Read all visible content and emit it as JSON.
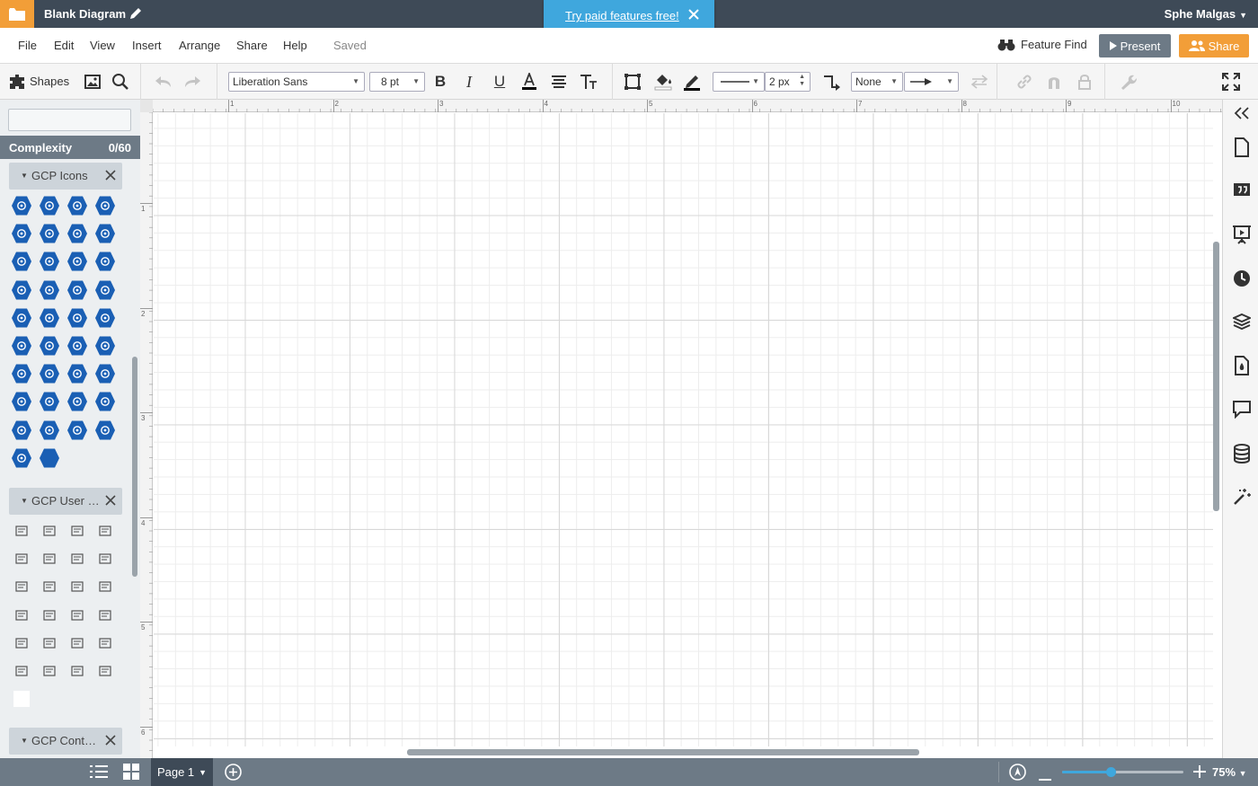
{
  "topbar": {
    "doc_title": "Blank Diagram",
    "promo_text": "Try paid features free!",
    "user_name": "Sphe Malgas",
    "user_caret": "▼"
  },
  "menu": {
    "items": [
      "File",
      "Edit",
      "View",
      "Insert",
      "Arrange",
      "Share",
      "Help"
    ],
    "status": "Saved",
    "feature_find": "Feature Find",
    "present": "Present",
    "share": "Share"
  },
  "toolbar": {
    "shapes_label": "Shapes",
    "font_family": "Liberation Sans",
    "font_size": "8 pt",
    "line_width": "2 px",
    "line_start": "None"
  },
  "sidebar": {
    "search_placeholder": "",
    "complexity_label": "Complexity",
    "complexity_value": "0/60",
    "libraries": [
      {
        "label": "GCP Icons"
      },
      {
        "label": "GCP User a…"
      },
      {
        "label": "GCP Contai…"
      }
    ],
    "gcp_icon_count": 38,
    "user_icon_count": 25
  },
  "colors": {
    "topbar": "#3e4a57",
    "accent_orange": "#f29e38",
    "promo_blue": "#3fa7dd",
    "gcp_blue": "#1a5fb4",
    "panel_gray": "#6d7a86"
  },
  "ruler": {
    "top_labels": [
      "1",
      "2",
      "3",
      "4",
      "5",
      "6",
      "7",
      "8",
      "9",
      "10"
    ],
    "left_labels": [
      "1",
      "2",
      "3",
      "4",
      "5",
      "6"
    ]
  },
  "bottombar": {
    "page_label": "Page 1",
    "zoom_label": "75%",
    "zoom_fraction": 0.4
  }
}
